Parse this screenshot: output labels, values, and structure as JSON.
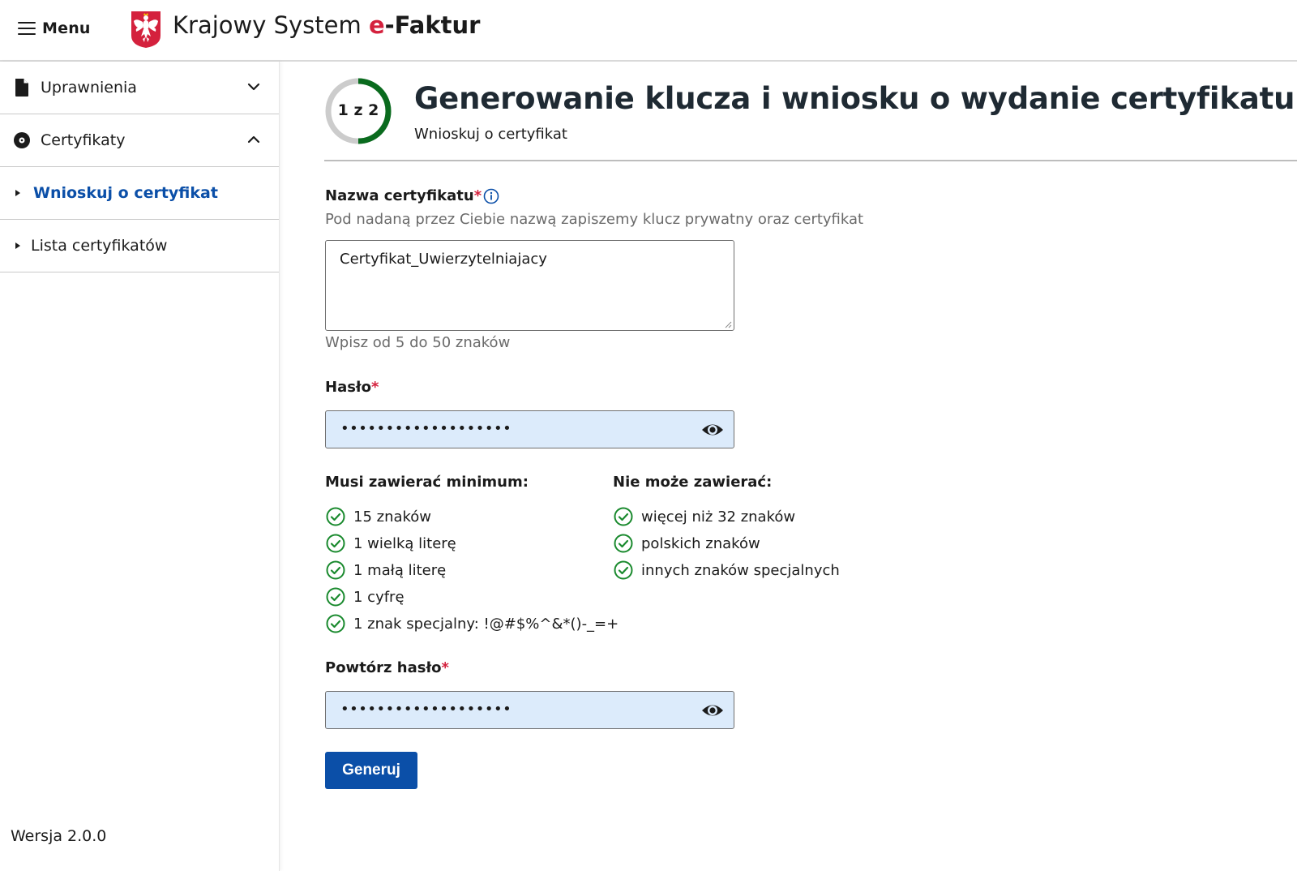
{
  "header": {
    "menu_label": "Menu",
    "title_part1": "Krajowy System ",
    "title_e": "e",
    "title_part2": "-Faktur",
    "brand_color": "#d4213d"
  },
  "sidebar": {
    "items": [
      {
        "label": "Uprawnienia",
        "icon": "document-icon",
        "expanded": false
      },
      {
        "label": "Certyfikaty",
        "icon": "disc-icon",
        "expanded": true
      }
    ],
    "subitems": [
      {
        "label": "Wnioskuj o certyfikat",
        "active": true
      },
      {
        "label": "Lista certyfikatów",
        "active": false
      }
    ],
    "version": "Wersja 2.0.0"
  },
  "step": {
    "label": "1 z 2",
    "current": 1,
    "total": 2,
    "progress_color": "#0a6b1e",
    "track_color": "#cccccc"
  },
  "page": {
    "title": "Generowanie klucza i wniosku o wydanie certyfikatu",
    "subtitle": "Wnioskuj o certyfikat"
  },
  "form": {
    "cert_name": {
      "label": "Nazwa certyfikatu",
      "required_mark": "*",
      "description": "Pod nadaną przez Ciebie nazwą zapiszemy klucz prywatny oraz certyfikat",
      "value": "Certyfikat_Uwierzytelniajacy",
      "hint": "Wpisz od 5 do 50 znaków"
    },
    "password": {
      "label": "Hasło",
      "required_mark": "*",
      "masked_value": "•••••••••••••••••••"
    },
    "rules": {
      "must_title": "Musi zawierać minimum:",
      "must": [
        "15 znaków",
        "1 wielką literę",
        "1 małą literę",
        "1 cyfrę",
        "1 znak specjalny: !@#$%^&*()-_=+"
      ],
      "must_not_title": "Nie może zawierać:",
      "must_not": [
        "więcej niż 32 znaków",
        "polskich znaków",
        "innych znaków specjalnych"
      ],
      "check_color": "#1a8a2e"
    },
    "password_repeat": {
      "label": "Powtórz hasło",
      "required_mark": "*",
      "masked_value": "•••••••••••••••••••"
    },
    "submit_label": "Generuj",
    "accent_color": "#0b4fa8"
  }
}
